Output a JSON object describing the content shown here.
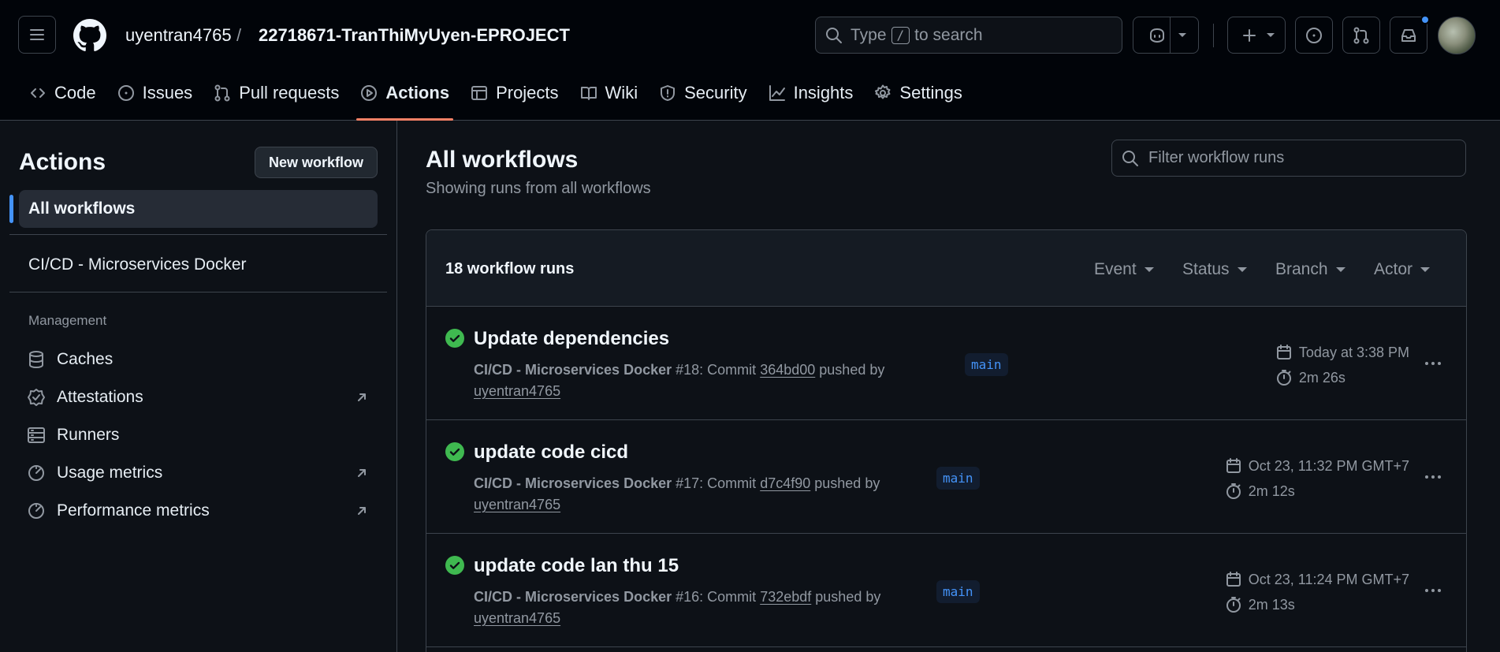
{
  "header": {
    "owner": "uyentran4765",
    "separator": "/",
    "repo": "22718671-TranThiMyUyen-EPROJECT",
    "search_before": "Type",
    "search_key": "/",
    "search_after": "to search"
  },
  "tabs": [
    {
      "label": "Code",
      "icon": "code-icon"
    },
    {
      "label": "Issues",
      "icon": "issue-icon"
    },
    {
      "label": "Pull requests",
      "icon": "pull-request-icon"
    },
    {
      "label": "Actions",
      "icon": "play-icon",
      "active": true
    },
    {
      "label": "Projects",
      "icon": "table-icon"
    },
    {
      "label": "Wiki",
      "icon": "book-icon"
    },
    {
      "label": "Security",
      "icon": "shield-icon"
    },
    {
      "label": "Insights",
      "icon": "graph-icon"
    },
    {
      "label": "Settings",
      "icon": "gear-icon"
    }
  ],
  "sidebar": {
    "title": "Actions",
    "new_workflow": "New workflow",
    "all_workflows": "All workflows",
    "workflow_item": "CI/CD - Microservices Docker",
    "management_label": "Management",
    "management_items": [
      {
        "label": "Caches",
        "icon": "database-icon"
      },
      {
        "label": "Attestations",
        "icon": "verified-icon"
      },
      {
        "label": "Runners",
        "icon": "server-icon"
      },
      {
        "label": "Usage metrics",
        "icon": "meter-icon"
      },
      {
        "label": "Performance metrics",
        "icon": "meter-icon"
      }
    ]
  },
  "main": {
    "title": "All workflows",
    "subtitle": "Showing runs from all workflows",
    "filter_placeholder": "Filter workflow runs",
    "runs_count": "18 workflow runs",
    "filters": [
      "Event",
      "Status",
      "Branch",
      "Actor"
    ],
    "runs": [
      {
        "title": "Update dependencies",
        "workflow": "CI/CD - Microservices Docker",
        "number": "#18: Commit",
        "commit": "364bd00",
        "pushed_by": "pushed by",
        "user": "uyentran4765",
        "branch": "main",
        "date": "Today at 3:38 PM",
        "duration": "2m 26s",
        "status": "success"
      },
      {
        "title": "update code cicd",
        "workflow": "CI/CD - Microservices Docker",
        "number": "#17: Commit",
        "commit": "d7c4f90",
        "pushed_by": "pushed by",
        "user": "uyentran4765",
        "branch": "main",
        "date": "Oct 23, 11:32 PM GMT+7",
        "duration": "2m 12s",
        "status": "success"
      },
      {
        "title": "update code lan thu 15",
        "workflow": "CI/CD - Microservices Docker",
        "number": "#16: Commit",
        "commit": "732ebdf",
        "pushed_by": "pushed by",
        "user": "uyentran4765",
        "branch": "main",
        "date": "Oct 23, 11:24 PM GMT+7",
        "duration": "2m 13s",
        "status": "success"
      }
    ]
  },
  "colors": {
    "background": "#0d1117",
    "header_bg": "#010409",
    "accent_blue": "#4493f8",
    "success_green": "#3fb950",
    "active_tab_underline": "#f78166",
    "border": "#3d444d"
  }
}
